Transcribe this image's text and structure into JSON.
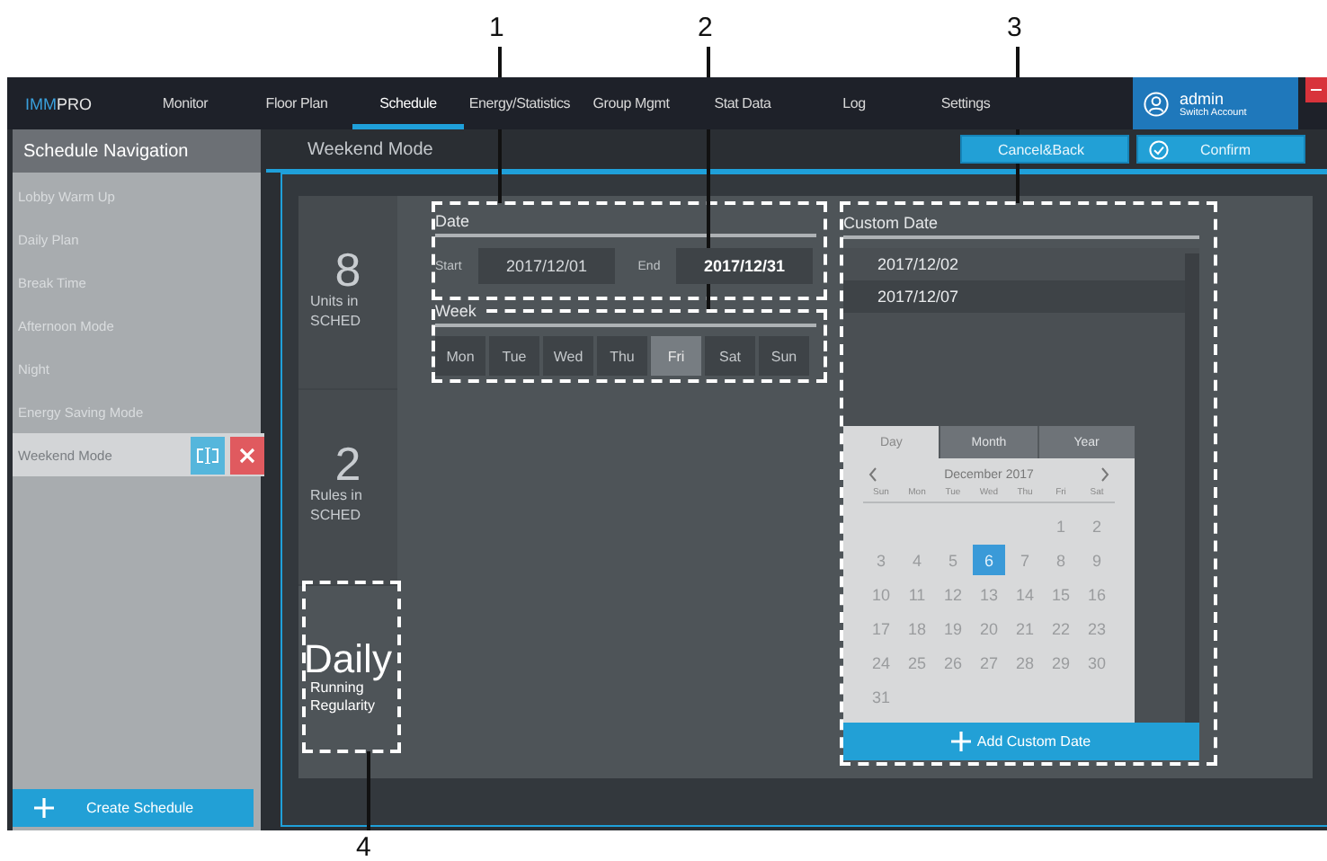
{
  "callouts": [
    {
      "label": "1"
    },
    {
      "label": "2"
    },
    {
      "label": "3"
    },
    {
      "label": "4"
    }
  ],
  "nav": {
    "logo_accent": "IMM",
    "logo_rest": "PRO",
    "items": [
      {
        "label": "Monitor",
        "selected": false
      },
      {
        "label": "Floor Plan",
        "selected": false
      },
      {
        "label": "Schedule",
        "selected": true
      },
      {
        "label": "Energy/Statistics",
        "selected": false
      },
      {
        "label": "Group Mgmt",
        "selected": false
      },
      {
        "label": "Stat Data",
        "selected": false
      },
      {
        "label": "Log",
        "selected": false
      },
      {
        "label": "Settings",
        "selected": false
      }
    ],
    "user": {
      "name": "admin",
      "action": "Switch Account"
    }
  },
  "sidebar": {
    "title": "Schedule Navigation",
    "items": [
      {
        "label": "Lobby Warm Up",
        "selected": false
      },
      {
        "label": "Daily Plan",
        "selected": false
      },
      {
        "label": "Break Time",
        "selected": false
      },
      {
        "label": "Afternoon Mode",
        "selected": false
      },
      {
        "label": "Night",
        "selected": false
      },
      {
        "label": "Energy Saving Mode",
        "selected": false
      },
      {
        "label": "Weekend Mode",
        "selected": true
      }
    ],
    "create_button": "Create Schedule"
  },
  "header": {
    "title": "Weekend Mode",
    "buttons": [
      {
        "label": "Cancel&Back",
        "kind": "back"
      },
      {
        "label": "Confirm",
        "kind": "confirm"
      }
    ]
  },
  "stats": [
    {
      "value": "8",
      "label": "Units in SCHED"
    },
    {
      "value": "2",
      "label": "Rules in SCHED"
    },
    {
      "value": "Daily",
      "label": "Running Regularity"
    }
  ],
  "date": {
    "title": "Date",
    "start_label": "Start",
    "start": "2017/12/01",
    "end_label": "End",
    "end": "2017/12/31"
  },
  "week": {
    "title": "Week",
    "days": [
      {
        "label": "Mon",
        "selected": false
      },
      {
        "label": "Tue",
        "selected": false
      },
      {
        "label": "Wed",
        "selected": false
      },
      {
        "label": "Thu",
        "selected": false
      },
      {
        "label": "Fri",
        "selected": true
      },
      {
        "label": "Sat",
        "selected": false
      },
      {
        "label": "Sun",
        "selected": false
      }
    ]
  },
  "custom_date": {
    "title": "Custom Date",
    "dates": [
      "2017/12/02",
      "2017/12/07"
    ],
    "add_button": "Add Custom Date"
  },
  "calendar": {
    "tabs": [
      {
        "label": "Day",
        "selected": true
      },
      {
        "label": "Month",
        "selected": false
      },
      {
        "label": "Year",
        "selected": false
      }
    ],
    "month": "December 2017",
    "weekdays": [
      "Sun",
      "Mon",
      "Tue",
      "Wed",
      "Thu",
      "Fri",
      "Sat"
    ],
    "weeks": [
      [
        {
          "label": "1",
          "selected": false
        },
        {
          "label": "2",
          "selected": false
        }
      ],
      [
        {
          "label": "3",
          "selected": false
        },
        {
          "label": "4",
          "selected": false
        },
        {
          "label": "5",
          "selected": false
        },
        {
          "label": "6",
          "selected": true
        },
        {
          "label": "7",
          "selected": false
        },
        {
          "label": "8",
          "selected": false
        },
        {
          "label": "9",
          "selected": false
        }
      ],
      [
        {
          "label": "10",
          "selected": false
        },
        {
          "label": "11",
          "selected": false
        },
        {
          "label": "12",
          "selected": false
        },
        {
          "label": "13",
          "selected": false
        },
        {
          "label": "14",
          "selected": false
        },
        {
          "label": "15",
          "selected": false
        },
        {
          "label": "16",
          "selected": false
        }
      ],
      [
        {
          "label": "17",
          "selected": false
        },
        {
          "label": "18",
          "selected": false
        },
        {
          "label": "19",
          "selected": false
        },
        {
          "label": "20",
          "selected": false
        },
        {
          "label": "21",
          "selected": false
        },
        {
          "label": "22",
          "selected": false
        },
        {
          "label": "23",
          "selected": false
        }
      ],
      [
        {
          "label": "24",
          "selected": false
        },
        {
          "label": "25",
          "selected": false
        },
        {
          "label": "26",
          "selected": false
        },
        {
          "label": "27",
          "selected": false
        },
        {
          "label": "28",
          "selected": false
        },
        {
          "label": "29",
          "selected": false
        },
        {
          "label": "30",
          "selected": false
        }
      ],
      [
        {
          "label": "31",
          "selected": false
        }
      ]
    ]
  }
}
